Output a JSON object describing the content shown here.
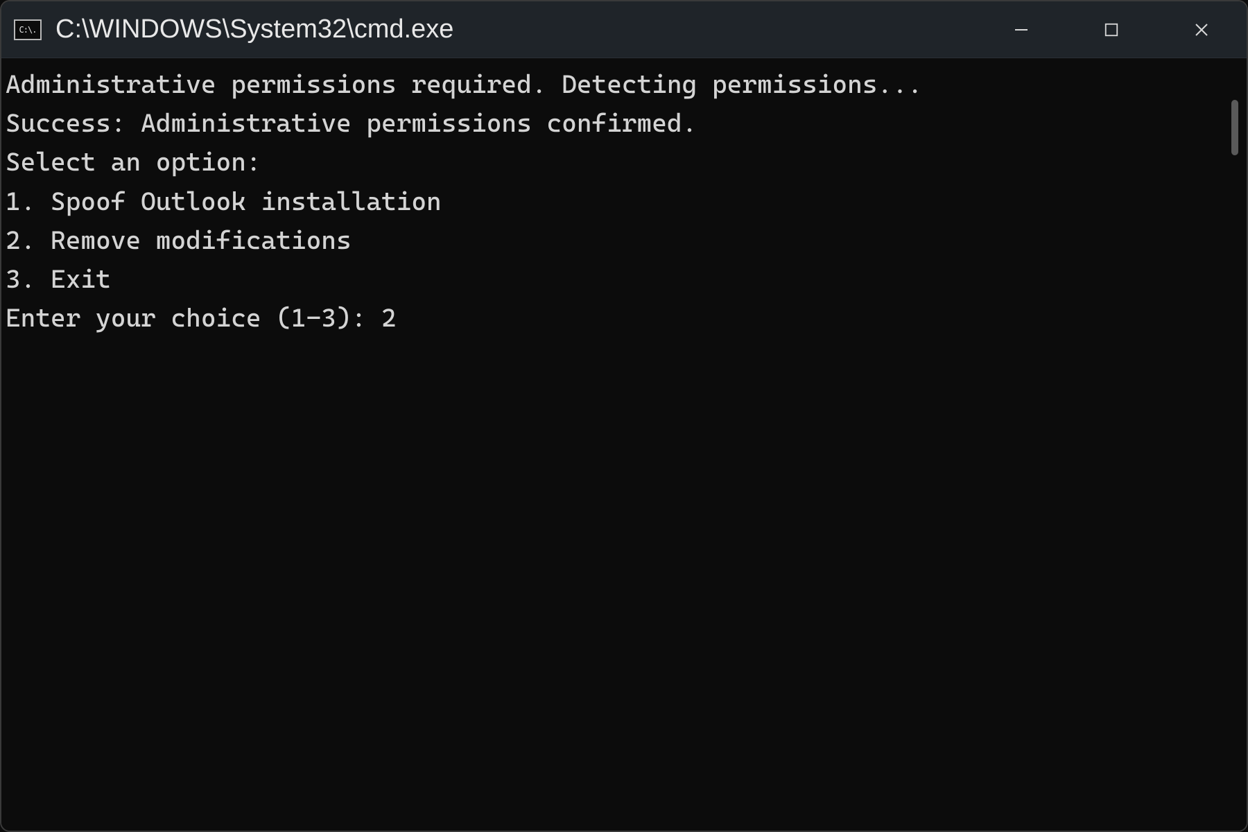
{
  "window": {
    "icon_label": "C:\\.",
    "title": "C:\\WINDOWS\\System32\\cmd.exe"
  },
  "terminal": {
    "lines": {
      "line1": "Administrative permissions required. Detecting permissions...",
      "line2": "Success: Administrative permissions confirmed.",
      "line3": "Select an option:",
      "line4": "1. Spoof Outlook installation",
      "line5": "2. Remove modifications",
      "line6": "3. Exit",
      "prompt": "Enter your choice (1-3): ",
      "input_value": "2"
    }
  }
}
